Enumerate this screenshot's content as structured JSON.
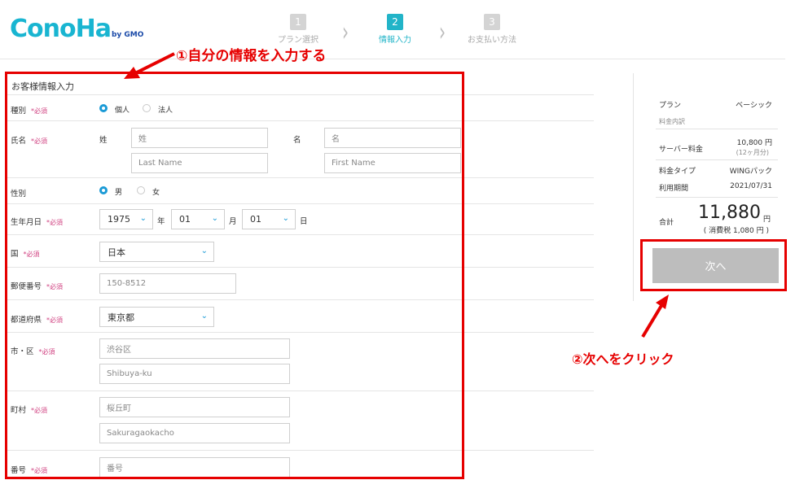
{
  "header": {
    "logo_text": "ConoHa",
    "logo_sub": "by GMO",
    "steps": [
      {
        "num": "1",
        "label": "プラン選択"
      },
      {
        "num": "2",
        "label": "情報入力"
      },
      {
        "num": "3",
        "label": "お支払い方法"
      }
    ],
    "accent": "#22b4c8"
  },
  "annotations": {
    "step1": "①自分の情報を入力する",
    "step2": "②次へをクリック",
    "color": "#e60000"
  },
  "form": {
    "title": "お客様情報入力",
    "required_mark": "*必須",
    "type": {
      "label": "種別",
      "options": [
        "個人",
        "法人"
      ],
      "selected": "個人"
    },
    "name": {
      "label": "氏名",
      "sei_label": "姓",
      "mei_label": "名",
      "sei_placeholder": "姓",
      "mei_placeholder": "名",
      "last_placeholder": "Last Name",
      "first_placeholder": "First Name"
    },
    "gender": {
      "label": "性別",
      "options": [
        "男",
        "女"
      ],
      "selected": "男"
    },
    "birthday": {
      "label": "生年月日",
      "year": "1975",
      "year_unit": "年",
      "month": "01",
      "month_unit": "月",
      "day": "01",
      "day_unit": "日"
    },
    "country": {
      "label": "国",
      "value": "日本"
    },
    "postal": {
      "label": "郵便番号",
      "placeholder": "150-8512"
    },
    "prefecture": {
      "label": "都道府県",
      "value": "東京都"
    },
    "city": {
      "label": "市・区",
      "placeholder_ja": "渋谷区",
      "placeholder_en": "Shibuya-ku"
    },
    "town": {
      "label": "町村",
      "placeholder_ja": "桜丘町",
      "placeholder_en": "Sakuragaokacho"
    },
    "number": {
      "label": "番号",
      "placeholder": "番号"
    }
  },
  "summary": {
    "plan_label": "プラン",
    "plan_value": "ベーシック",
    "breakdown_label": "料金内訳",
    "server_fee_label": "サーバー料金",
    "server_fee_value": "10,800 円",
    "server_fee_note": "(12ヶ月分)",
    "fee_type_label": "料金タイプ",
    "fee_type_value": "WINGパック",
    "period_label": "利用期間",
    "period_value": "2021/07/31",
    "total_label": "合計",
    "total_value": "11,880",
    "total_unit": "円",
    "tax_note": "( 消費税 1,080 円 )"
  },
  "buttons": {
    "next": "次へ"
  }
}
